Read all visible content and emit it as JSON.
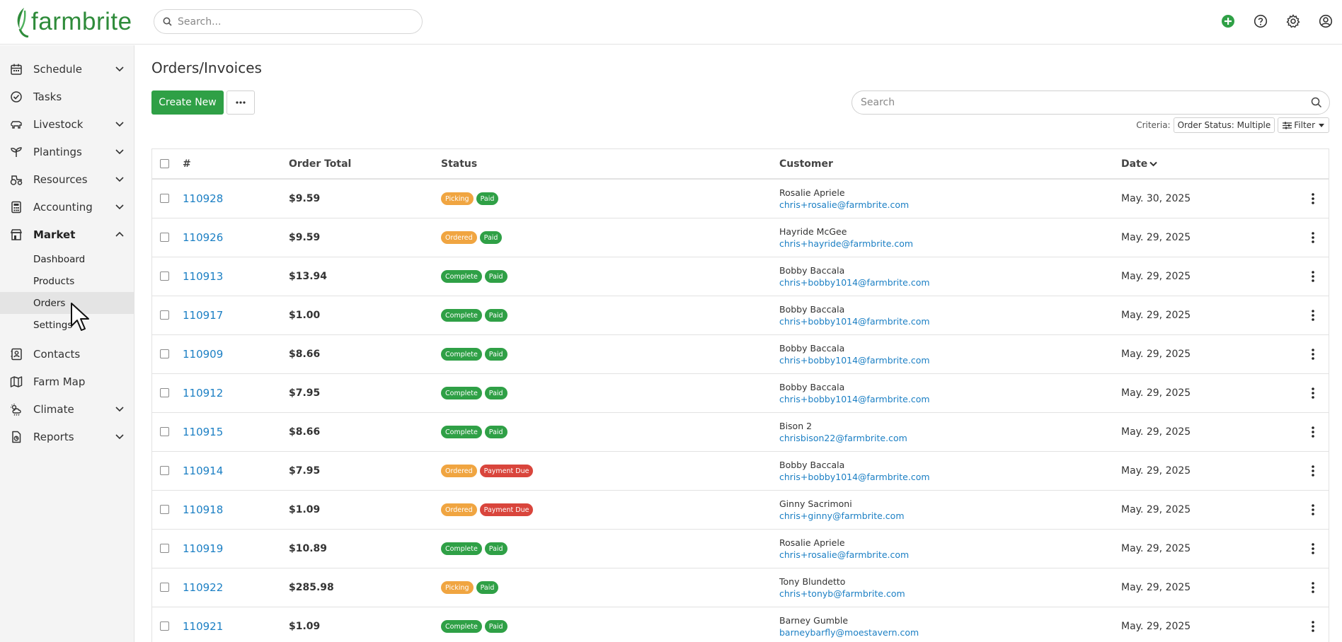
{
  "brand": {
    "name": "farmbrite",
    "color": "#2e8b3a"
  },
  "header": {
    "search_placeholder": "Search..."
  },
  "sidebar": {
    "items": [
      {
        "label": "Schedule",
        "icon": "calendar-icon",
        "chevron": "down"
      },
      {
        "label": "Tasks",
        "icon": "check-circle-icon",
        "chevron": ""
      },
      {
        "label": "Livestock",
        "icon": "livestock-icon",
        "chevron": "down"
      },
      {
        "label": "Plantings",
        "icon": "sprout-icon",
        "chevron": "down"
      },
      {
        "label": "Resources",
        "icon": "tractor-icon",
        "chevron": "down"
      },
      {
        "label": "Accounting",
        "icon": "calculator-icon",
        "chevron": "down"
      },
      {
        "label": "Market",
        "icon": "market-icon",
        "chevron": "up"
      }
    ],
    "market_sub": [
      {
        "label": "Dashboard"
      },
      {
        "label": "Products"
      },
      {
        "label": "Orders"
      },
      {
        "label": "Settings"
      }
    ],
    "items_after": [
      {
        "label": "Contacts",
        "icon": "contacts-icon",
        "chevron": ""
      },
      {
        "label": "Farm Map",
        "icon": "map-icon",
        "chevron": ""
      },
      {
        "label": "Climate",
        "icon": "weather-icon",
        "chevron": "down"
      },
      {
        "label": "Reports",
        "icon": "report-icon",
        "chevron": "down"
      }
    ]
  },
  "page": {
    "title": "Orders/Invoices",
    "create_label": "Create New",
    "search_placeholder": "Search",
    "criteria_label": "Criteria:",
    "criteria_value": "Order Status: Multiple",
    "filter_label": "Filter"
  },
  "table": {
    "headers": {
      "num": "#",
      "total": "Order Total",
      "status": "Status",
      "customer": "Customer",
      "date": "Date"
    },
    "status_colors": {
      "Picking": "#f0a541",
      "Ordered": "#f0a541",
      "Complete": "#2fa046",
      "Paid": "#2fa046",
      "Payment Due": "#d9453c"
    },
    "rows": [
      {
        "num": "110928",
        "total": "$9.59",
        "status": [
          "Picking",
          "Paid"
        ],
        "name": "Rosalie Apriele",
        "email": "chris+rosalie@farmbrite.com",
        "date": "May. 30, 2025"
      },
      {
        "num": "110926",
        "total": "$9.59",
        "status": [
          "Ordered",
          "Paid"
        ],
        "name": "Hayride McGee",
        "email": "chris+hayride@farmbrite.com",
        "date": "May. 29, 2025"
      },
      {
        "num": "110913",
        "total": "$13.94",
        "status": [
          "Complete",
          "Paid"
        ],
        "name": "Bobby Baccala",
        "email": "chris+bobby1014@farmbrite.com",
        "date": "May. 29, 2025"
      },
      {
        "num": "110917",
        "total": "$1.00",
        "status": [
          "Complete",
          "Paid"
        ],
        "name": "Bobby Baccala",
        "email": "chris+bobby1014@farmbrite.com",
        "date": "May. 29, 2025"
      },
      {
        "num": "110909",
        "total": "$8.66",
        "status": [
          "Complete",
          "Paid"
        ],
        "name": "Bobby Baccala",
        "email": "chris+bobby1014@farmbrite.com",
        "date": "May. 29, 2025"
      },
      {
        "num": "110912",
        "total": "$7.95",
        "status": [
          "Complete",
          "Paid"
        ],
        "name": "Bobby Baccala",
        "email": "chris+bobby1014@farmbrite.com",
        "date": "May. 29, 2025"
      },
      {
        "num": "110915",
        "total": "$8.66",
        "status": [
          "Complete",
          "Paid"
        ],
        "name": "Bison 2",
        "email": "chrisbison22@farmbrite.com",
        "date": "May. 29, 2025"
      },
      {
        "num": "110914",
        "total": "$7.95",
        "status": [
          "Ordered",
          "Payment Due"
        ],
        "name": "Bobby Baccala",
        "email": "chris+bobby1014@farmbrite.com",
        "date": "May. 29, 2025"
      },
      {
        "num": "110918",
        "total": "$1.09",
        "status": [
          "Ordered",
          "Payment Due"
        ],
        "name": "Ginny Sacrimoni",
        "email": "chris+ginny@farmbrite.com",
        "date": "May. 29, 2025"
      },
      {
        "num": "110919",
        "total": "$10.89",
        "status": [
          "Complete",
          "Paid"
        ],
        "name": "Rosalie Apriele",
        "email": "chris+rosalie@farmbrite.com",
        "date": "May. 29, 2025"
      },
      {
        "num": "110922",
        "total": "$285.98",
        "status": [
          "Picking",
          "Paid"
        ],
        "name": "Tony Blundetto",
        "email": "chris+tonyb@farmbrite.com",
        "date": "May. 29, 2025"
      },
      {
        "num": "110921",
        "total": "$1.09",
        "status": [
          "Complete",
          "Paid"
        ],
        "name": "Barney Gumble",
        "email": "barneybarfly@moestavern.com",
        "date": "May. 29, 2025"
      }
    ]
  }
}
